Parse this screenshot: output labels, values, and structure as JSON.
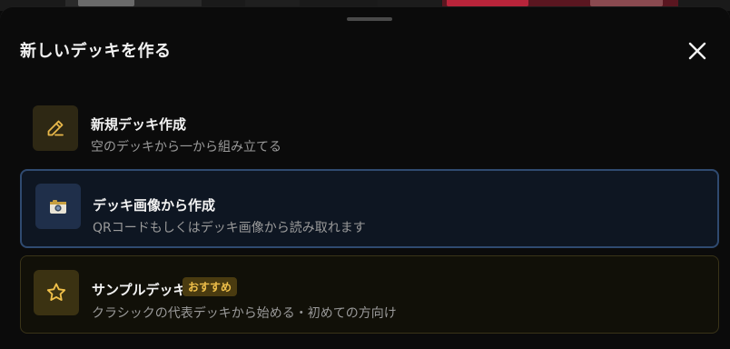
{
  "dialog": {
    "title": "新しいデッキを作る",
    "close_icon": "close-icon"
  },
  "options": [
    {
      "icon": "pencil-icon",
      "title": "新規デッキ作成",
      "description": "空のデッキから一から組み立てる"
    },
    {
      "icon": "camera-icon",
      "title": "デッキ画像から作成",
      "description": "QRコードもしくはデッキ画像から読み取れます"
    },
    {
      "icon": "star-icon",
      "title": "サンプルデッキ",
      "badge": "おすすめ",
      "description": "クラシックの代表デッキから始める・初めての方向け"
    }
  ],
  "colors": {
    "accent_gold": "#f0c04a",
    "selected_border": "#2f4a70",
    "text_primary": "#f2f2f2",
    "text_secondary": "#9a9a9a"
  }
}
